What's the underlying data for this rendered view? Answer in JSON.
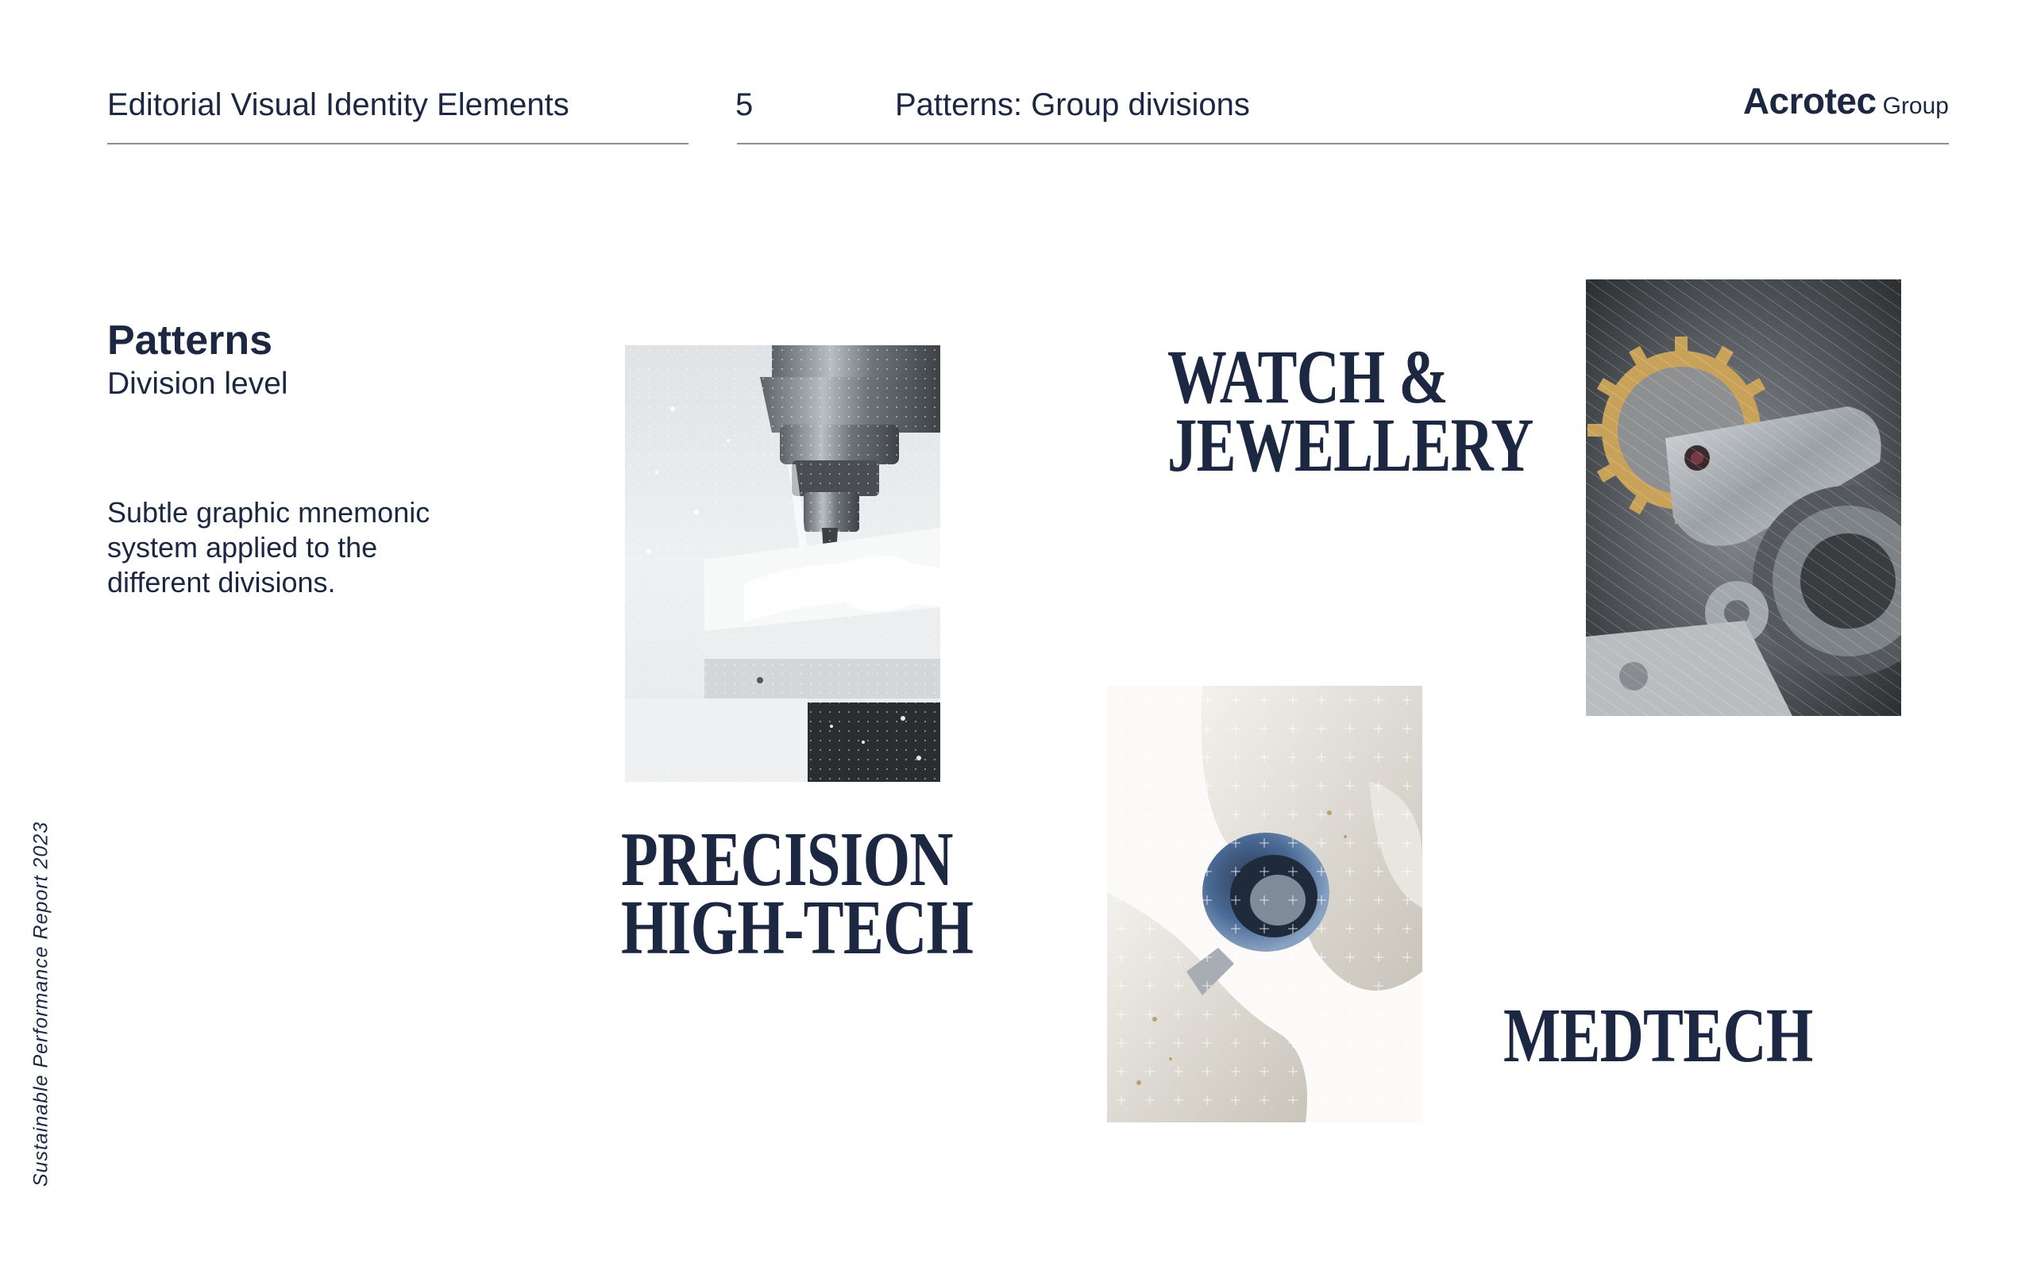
{
  "header": {
    "doc_title": "Editorial Visual Identity Elements",
    "page_number": "5",
    "section_title": "Patterns: Group divisions",
    "logo_main": "Acrotec",
    "logo_sub": "Group"
  },
  "intro": {
    "title": "Patterns",
    "subtitle": "Division level",
    "body": "Subtle graphic mnemonic system applied to the different divisions."
  },
  "side_caption": "Sustainable Performance Report 2023",
  "divisions": {
    "watch": {
      "line1": "WATCH &",
      "line2": "JEWELLERY"
    },
    "precision": {
      "line1": "PRECISION",
      "line2": "HIGH-TECH"
    },
    "medtech": {
      "line1": "MEDTECH"
    }
  },
  "colors": {
    "navy": "#1c2742",
    "rule": "#8a8f99",
    "gear_gold": "#c9a25a",
    "implant_blue": "#4a6a96"
  }
}
